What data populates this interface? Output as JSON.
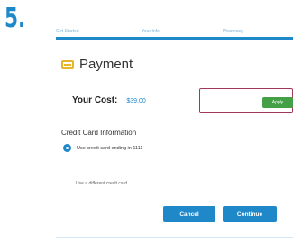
{
  "step_number": "5.",
  "stepper": {
    "steps": [
      "Get Started",
      "Your Info",
      "Pharmacy"
    ]
  },
  "payment": {
    "icon": "credit-card-icon",
    "title": "Payment"
  },
  "cost": {
    "label": "Your Cost:",
    "value": "$39.00"
  },
  "coupon": {
    "value": "",
    "apply_label": "Apply"
  },
  "credit_card": {
    "title": "Credit Card Information",
    "saved_card_label": "Use credit card ending in 1111",
    "selected": true,
    "different_card_label": "Use a different credit card"
  },
  "actions": {
    "cancel_label": "Cancel",
    "continue_label": "Continue"
  },
  "colors": {
    "accent": "#1f88c9",
    "apply": "#43a047",
    "coupon_border": "#a3365c",
    "icon": "#e7b52c"
  }
}
